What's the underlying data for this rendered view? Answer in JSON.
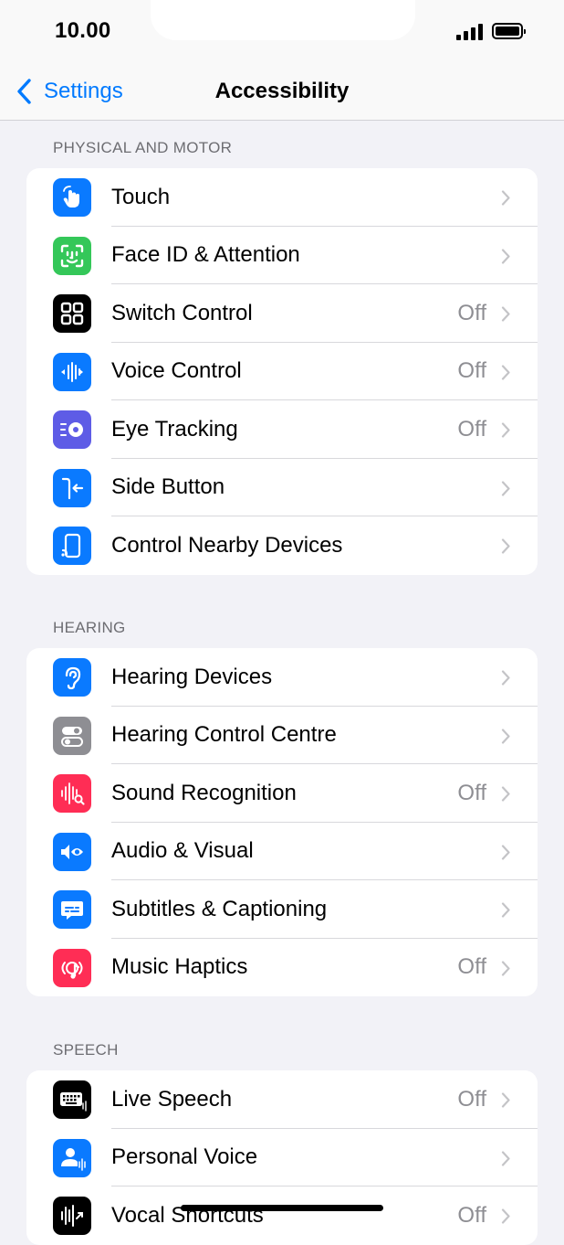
{
  "status": {
    "time": "10.00"
  },
  "nav": {
    "back_label": "Settings",
    "title": "Accessibility"
  },
  "sections": [
    {
      "header": "PHYSICAL AND MOTOR",
      "items": [
        {
          "label": "Touch",
          "value": "",
          "icon": "touch-icon",
          "color": "#0a7aff"
        },
        {
          "label": "Face ID & Attention",
          "value": "",
          "icon": "face-id-icon",
          "color": "#34c759"
        },
        {
          "label": "Switch Control",
          "value": "Off",
          "icon": "switch-control-icon",
          "color": "#000000"
        },
        {
          "label": "Voice Control",
          "value": "Off",
          "icon": "voice-control-icon",
          "color": "#0a7aff"
        },
        {
          "label": "Eye Tracking",
          "value": "Off",
          "icon": "eye-tracking-icon",
          "color": "#5e5ce6"
        },
        {
          "label": "Side Button",
          "value": "",
          "icon": "side-button-icon",
          "color": "#0a7aff"
        },
        {
          "label": "Control Nearby Devices",
          "value": "",
          "icon": "nearby-devices-icon",
          "color": "#0a7aff"
        }
      ]
    },
    {
      "header": "HEARING",
      "items": [
        {
          "label": "Hearing Devices",
          "value": "",
          "icon": "ear-icon",
          "color": "#0a7aff"
        },
        {
          "label": "Hearing Control Centre",
          "value": "",
          "icon": "toggles-icon",
          "color": "#8e8e93"
        },
        {
          "label": "Sound Recognition",
          "value": "Off",
          "icon": "sound-recognition-icon",
          "color": "#ff2d55"
        },
        {
          "label": "Audio & Visual",
          "value": "",
          "icon": "audio-visual-icon",
          "color": "#0a7aff"
        },
        {
          "label": "Subtitles & Captioning",
          "value": "",
          "icon": "subtitles-icon",
          "color": "#0a7aff"
        },
        {
          "label": "Music Haptics",
          "value": "Off",
          "icon": "music-haptics-icon",
          "color": "#ff2d55"
        }
      ]
    },
    {
      "header": "SPEECH",
      "items": [
        {
          "label": "Live Speech",
          "value": "Off",
          "icon": "keyboard-icon",
          "color": "#000000"
        },
        {
          "label": "Personal Voice",
          "value": "",
          "icon": "personal-voice-icon",
          "color": "#0a7aff"
        },
        {
          "label": "Vocal Shortcuts",
          "value": "Off",
          "icon": "vocal-shortcuts-icon",
          "color": "#000000"
        }
      ]
    }
  ]
}
